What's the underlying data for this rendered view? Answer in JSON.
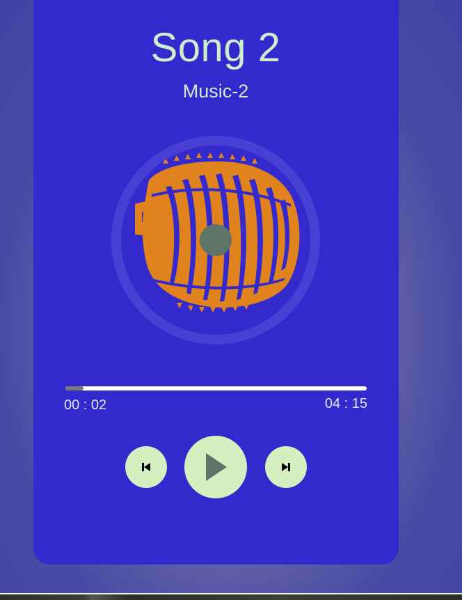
{
  "song": {
    "title": "Song 2",
    "artist": "Music-2"
  },
  "artwork": {
    "icon": "microphone-icon",
    "ring_color": "#4a3fd4",
    "art_color": "#e0821e",
    "hub_color": "#5e7466"
  },
  "progress": {
    "current_time": "00 : 02",
    "total_time": "04 : 15",
    "fraction": 0.06
  },
  "controls": {
    "prev_icon": "skip-back-icon",
    "play_icon": "play-icon",
    "next_icon": "skip-forward-icon"
  },
  "colors": {
    "card": "#3329cc",
    "text": "#cdeecb",
    "button": "#d4efc0",
    "track": "#ffffff",
    "track_fill": "#7a7a7a"
  }
}
